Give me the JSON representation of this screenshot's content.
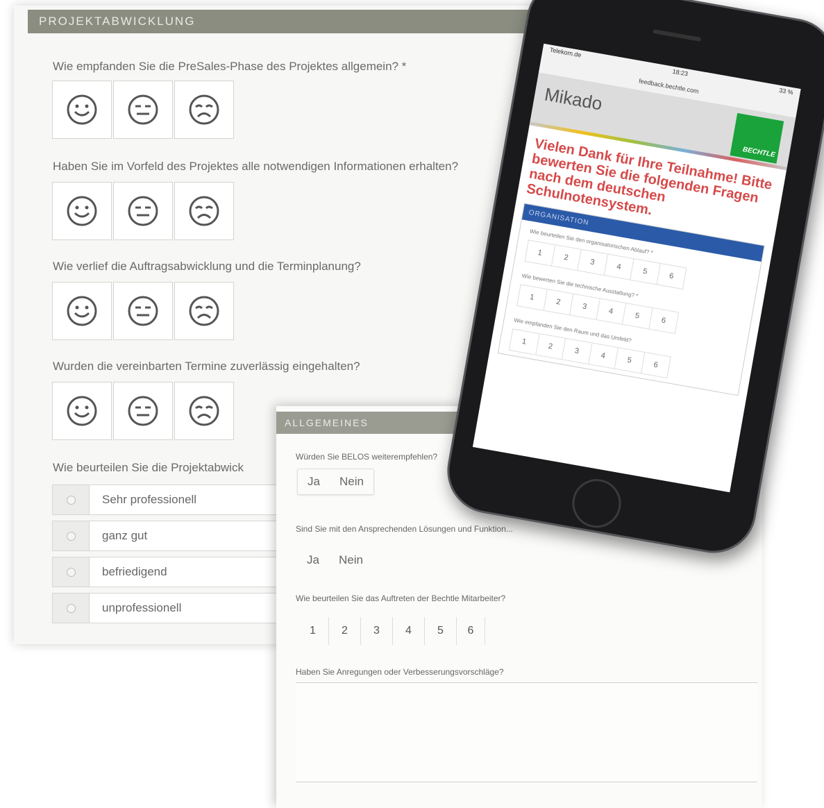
{
  "projekt": {
    "header": "PROJEKTABWICKLUNG",
    "questions": [
      "Wie empfanden Sie die PreSales-Phase des Projektes allgemein? *",
      "Haben Sie im Vorfeld des Projektes alle notwendigen Informationen erhalten?",
      "Wie verlief die Auftragsabwicklung und die Terminplanung?",
      "Wurden die vereinbarten Termine zuverlässig eingehalten?",
      "Wie beurteilen Sie die Projektabwick"
    ],
    "radio_options": [
      "Sehr professionell",
      "ganz gut",
      "befriedigend",
      "unprofessionell"
    ],
    "smiley_icons": [
      "happy-face-icon",
      "neutral-face-icon",
      "sad-face-icon"
    ]
  },
  "allgemeines": {
    "header": "ALLGEMEINES",
    "q1": "Würden Sie BELOS weiterempfehlen?",
    "q2": "Sind Sie mit den Ansprechenden Lösungen und Funktion...",
    "q3": "Wie beurteilen Sie das Auftreten der Bechtle Mitarbeiter?",
    "q4": "Haben Sie Anregungen oder Verbesserungsvorschläge?",
    "yes": "Ja",
    "no": "Nein",
    "grades": [
      "1",
      "2",
      "3",
      "4",
      "5",
      "6"
    ]
  },
  "phone": {
    "carrier": "Telekom.de",
    "time": "18:23",
    "battery": "33 %",
    "url": "feedback.bechtle.com",
    "app_title": "Mikado",
    "logo_text": "BECHTLE",
    "brand_color": "#1aa33a",
    "thanks": "Vielen Dank für Ihre Teilnahme! Bitte bewerten Sie die folgenden Fragen nach dem deutschen Schulnotensystem.",
    "section": "ORGANISATION",
    "questions": [
      "Wie beurteilen Sie den organisatorischen Ablauf? *",
      "Wie bewerten Sie die technische Ausstattung? *",
      "Wie empfanden Sie den Raum und das Umfeld?"
    ],
    "grades": [
      "1",
      "2",
      "3",
      "4",
      "5",
      "6"
    ]
  }
}
